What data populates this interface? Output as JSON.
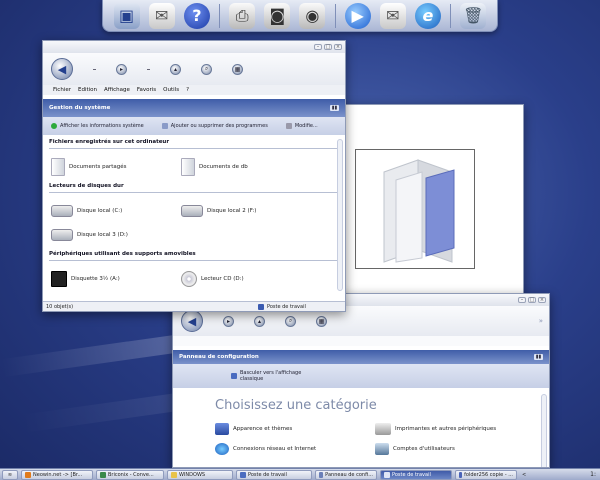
{
  "desktop": {
    "background": "#2a3f8a"
  },
  "dock": {
    "icons": [
      "computer-icon",
      "documents-icon",
      "help-icon",
      "printer-icon",
      "camera-icon",
      "disc-icon",
      "media-player-icon",
      "mail-icon",
      "internet-explorer-icon",
      "trash-icon"
    ]
  },
  "win1": {
    "menu": [
      "Fichier",
      "Edition",
      "Affichage",
      "Favoris",
      "Outils",
      "?"
    ],
    "panel_title": "Gestion du système",
    "tasks": [
      "Afficher les informations système",
      "Ajouter ou supprimer des programmes",
      "Modifie..."
    ],
    "sections": [
      {
        "title": "Fichiers enregistrés sur cet ordinateur",
        "items": [
          "Documents partagés",
          "Documents de db"
        ]
      },
      {
        "title": "Lecteurs de disques dur",
        "items": [
          "Disque local (C:)",
          "Disque local 2 (F:)",
          "Disque local 3 (D:)"
        ]
      },
      {
        "title": "Périphériques utilisant des supports amovibles",
        "items": [
          "Disquette 3½ (A:)",
          "Lecteur CD (D:)"
        ]
      }
    ],
    "status_left": "10 objet(s)",
    "status_right": "Poste de travail"
  },
  "win3": {
    "panel_title": "Panneau de configuration",
    "switch_view": "Basculer vers l'affichage classique",
    "heading": "Choisissez une catégorie",
    "categories": [
      "Apparence et thèmes",
      "Imprimantes et autres périphériques",
      "Connexions réseau et Internet",
      "Comptes d'utilisateurs"
    ]
  },
  "taskbar": {
    "items": [
      "Neowin.net -> [Br...",
      "Briconix - Conve...",
      "WINDOWS",
      "Poste de travail",
      "Panneau de confi...",
      "Poste de travail",
      "folder256 copie - ...",
      "<"
    ],
    "clock": "1:"
  }
}
